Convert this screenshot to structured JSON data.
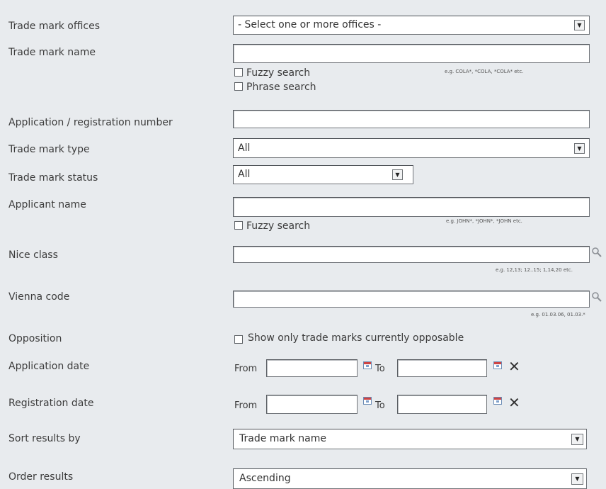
{
  "labels": {
    "offices": "Trade mark offices",
    "name": "Trade mark name",
    "appnum": "Application / registration number",
    "type": "Trade mark type",
    "status": "Trade mark status",
    "applicant": "Applicant name",
    "nice": "Nice class",
    "vienna": "Vienna code",
    "opposition": "Opposition",
    "appdate": "Application date",
    "regdate": "Registration date",
    "sort": "Sort results by",
    "order": "Order results"
  },
  "fields": {
    "offices_value": "- Select one or more offices -",
    "type_value": "All",
    "status_value": "All",
    "sort_value": "Trade mark name",
    "order_value": "Ascending"
  },
  "checkboxes": {
    "name_fuzzy": "Fuzzy search",
    "name_phrase": "Phrase search",
    "applicant_fuzzy": "Fuzzy search",
    "opposition": "Show only trade marks currently opposable"
  },
  "hints": {
    "name": "e.g. COLA*, *COLA, *COLA* etc.",
    "applicant": "e.g. JOHN*, *JOHN*, *JOHN etc.",
    "nice": "e.g. 12,13; 12..15; 1,14,20 etc.",
    "vienna": "e.g. 01.03.06, 01.03.*"
  },
  "date": {
    "from": "From",
    "to": "To",
    "clear": "✕"
  },
  "icons": {
    "dropdown": "dropdown-arrow-icon",
    "search": "magnifier-icon",
    "calendar": "calendar-icon",
    "clear": "clear-x-icon"
  }
}
